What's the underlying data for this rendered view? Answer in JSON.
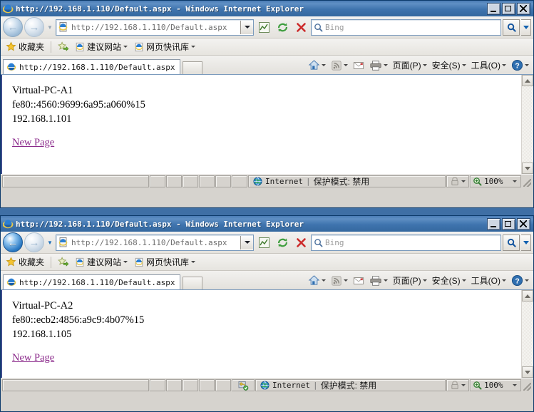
{
  "windows": [
    {
      "title": "http://192.168.1.110/Default.aspx - Windows Internet Explorer",
      "address": "http://192.168.1.110/Default.aspx",
      "search_placeholder": "Bing",
      "tab_label": "http://192.168.1.110/Default.aspx",
      "back_enabled": false,
      "page": {
        "hostname": "Virtual-PC-A1",
        "ipv6": "fe80::4560:9699:6a95:a060%15",
        "ipv4": "192.168.1.101",
        "link": "New Page"
      },
      "status": {
        "zone": "Internet",
        "separator": "|",
        "protected_mode": "保护模式: 禁用",
        "zoom": "100%",
        "has_key_icon": false
      }
    },
    {
      "title": "http://192.168.1.110/Default.aspx - Windows Internet Explorer",
      "address": "http://192.168.1.110/Default.aspx",
      "search_placeholder": "Bing",
      "tab_label": "http://192.168.1.110/Default.aspx",
      "back_enabled": true,
      "page": {
        "hostname": "Virtual-PC-A2",
        "ipv6": "fe80::ecb2:4856:a9c9:4b07%15",
        "ipv4": "192.168.1.105",
        "link": "New Page"
      },
      "status": {
        "zone": "Internet",
        "separator": "|",
        "protected_mode": "保护模式: 禁用",
        "zoom": "100%",
        "has_key_icon": true
      }
    }
  ],
  "favorites_bar": {
    "favorites_label": "收藏夹",
    "items": [
      {
        "label": "建议网站",
        "icon": "ie-icon",
        "has_caret": true
      },
      {
        "label": "网页快讯库",
        "icon": "ie-icon",
        "has_caret": true
      }
    ]
  },
  "command_bar": {
    "items": [
      {
        "label": "",
        "icon": "home-icon",
        "has_caret": true
      },
      {
        "label": "",
        "icon": "rss-icon",
        "has_caret": true
      },
      {
        "label": "",
        "icon": "mail-icon",
        "has_caret": false
      },
      {
        "label": "",
        "icon": "print-icon",
        "has_caret": true
      },
      {
        "label": "页面(P)",
        "icon": "",
        "has_caret": true
      },
      {
        "label": "安全(S)",
        "icon": "",
        "has_caret": true
      },
      {
        "label": "工具(O)",
        "icon": "",
        "has_caret": true
      },
      {
        "label": "",
        "icon": "help-icon",
        "has_caret": true
      }
    ]
  },
  "window_controls": {
    "minimize": "_",
    "maximize": "□",
    "close": "×"
  },
  "colors": {
    "titlebar": "#3f74ae",
    "desktop": "#3f6fa5",
    "link": "#8b2a8b",
    "chrome": "#d6d3ce"
  }
}
